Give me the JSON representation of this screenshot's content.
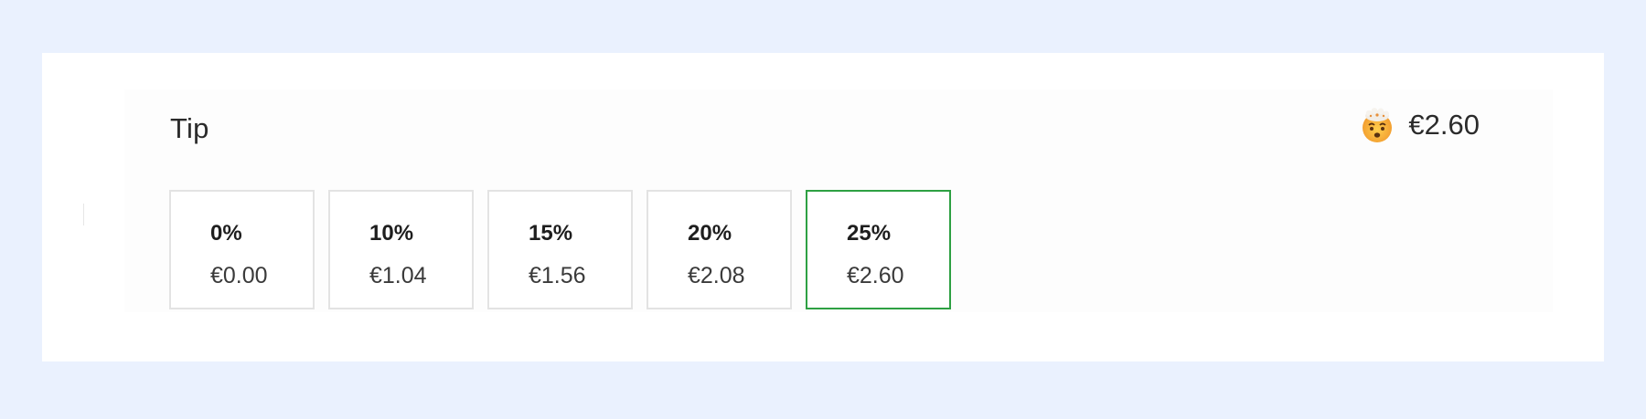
{
  "tip": {
    "label": "Tip",
    "selected_amount": "€2.60",
    "emoji_icon": "exploding-head-icon"
  },
  "options": [
    {
      "percent": "0%",
      "amount": "€0.00",
      "selected": false
    },
    {
      "percent": "10%",
      "amount": "€1.04",
      "selected": false
    },
    {
      "percent": "15%",
      "amount": "€1.56",
      "selected": false
    },
    {
      "percent": "20%",
      "amount": "€2.08",
      "selected": false
    },
    {
      "percent": "25%",
      "amount": "€2.60",
      "selected": true
    }
  ],
  "colors": {
    "background": "#eaf1fe",
    "selected_border": "#2ea043",
    "default_border": "#e3e3e3"
  }
}
